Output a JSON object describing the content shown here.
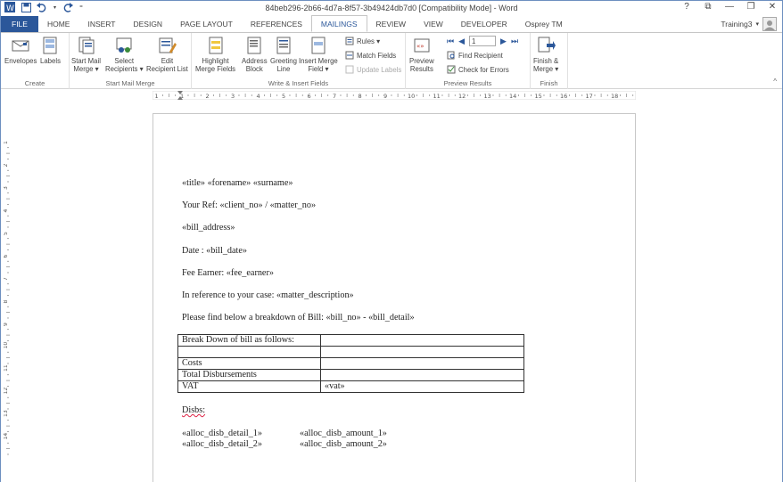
{
  "window": {
    "title": "84beb296-2b66-4d7a-8f57-3b49424db7d0 [Compatibility Mode] - Word",
    "controls": [
      "?",
      "⧉",
      "—",
      "❐",
      "✕"
    ]
  },
  "account": {
    "name": "Training3"
  },
  "tabs": [
    "FILE",
    "HOME",
    "INSERT",
    "DESIGN",
    "PAGE LAYOUT",
    "REFERENCES",
    "MAILINGS",
    "REVIEW",
    "VIEW",
    "DEVELOPER",
    "Osprey TM"
  ],
  "active_tab": "MAILINGS",
  "ribbon": {
    "groups": {
      "create": "Create",
      "start_mail_merge": "Start Mail Merge",
      "write_insert": "Write & Insert Fields",
      "preview": "Preview Results",
      "finish": "Finish"
    },
    "buttons": {
      "envelopes": "Envelopes",
      "labels": "Labels",
      "start_mail_merge_1": "Start Mail",
      "start_mail_merge_2": "Merge ▾",
      "select_recipients_1": "Select",
      "select_recipients_2": "Recipients ▾",
      "edit_recipient_1": "Edit",
      "edit_recipient_2": "Recipient List",
      "highlight_1": "Highlight",
      "highlight_2": "Merge Fields",
      "address_1": "Address",
      "address_2": "Block",
      "greeting_1": "Greeting",
      "greeting_2": "Line",
      "insert_field_1": "Insert Merge",
      "insert_field_2": "Field ▾",
      "rules": "Rules ▾",
      "match_fields": "Match Fields",
      "update_labels": "Update Labels",
      "preview_1": "Preview",
      "preview_2": "Results",
      "record_number": "1",
      "find_recipient": "Find Recipient",
      "check_errors": "Check for Errors",
      "finish_1": "Finish &",
      "finish_2": "Merge ▾"
    }
  },
  "ruler_numbers": [
    "1",
    "1",
    "2",
    "3",
    "4",
    "5",
    "6",
    "7",
    "8",
    "9",
    "10",
    "11",
    "12",
    "13",
    "14",
    "15",
    "16",
    "17",
    "18",
    "19"
  ],
  "vruler_numbers": [
    "1",
    "2",
    "3",
    "4",
    "5",
    "6",
    "7",
    "8",
    "9",
    "10",
    "11",
    "12",
    "13",
    "14"
  ],
  "document": {
    "line_name": "«title» «forename» «surname»",
    "line_ref": "Your Ref: «client_no» / «matter_no»",
    "line_address": "«bill_address»",
    "line_date": "Date : «bill_date»",
    "line_fee": "Fee Earner: «fee_earner»",
    "line_case": "In reference to your case: «matter_description»",
    "line_bill": "Please find below a breakdown of Bill: «bill_no» - «bill_detail»",
    "table": [
      [
        "Break Down of bill as follows:",
        ""
      ],
      [
        "",
        ""
      ],
      [
        "Costs",
        ""
      ],
      [
        "Total Disbursements",
        ""
      ],
      [
        "VAT",
        "«vat»"
      ]
    ],
    "disbs_heading": "Disbs:",
    "disb_rows": [
      {
        "detail": "«alloc_disb_detail_1»",
        "amount": "«alloc_disb_amount_1»"
      },
      {
        "detail": "«alloc_disb_detail_2»",
        "amount": "«alloc_disb_amount_2»"
      }
    ]
  },
  "colors": {
    "file_tab": "#2b579a",
    "accent": "#2b579a",
    "frame": "#6d8fc0"
  }
}
